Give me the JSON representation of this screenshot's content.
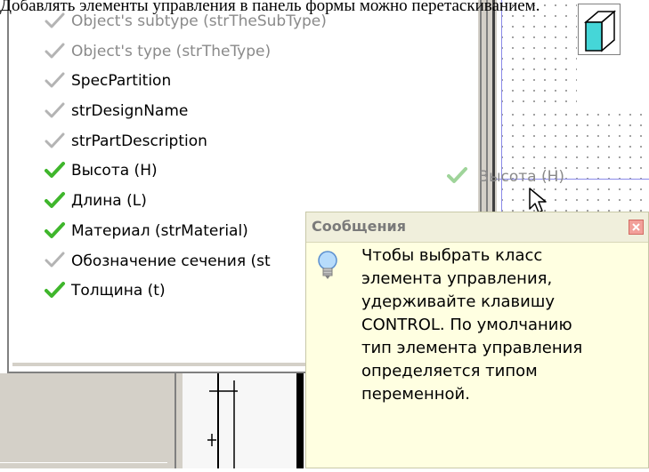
{
  "caption": "Добавлять элементы управления в панель формы можно перетаскиванием.",
  "variables": [
    {
      "label": "Object's subtype (strTheSubType)",
      "checked": false,
      "disabled": true
    },
    {
      "label": "Object's type (strTheType)",
      "checked": false,
      "disabled": true
    },
    {
      "label": "SpecPartition",
      "checked": false,
      "disabled": false
    },
    {
      "label": "strDesignName",
      "checked": false,
      "disabled": false
    },
    {
      "label": "strPartDescription",
      "checked": false,
      "disabled": false
    },
    {
      "label": "Высота (H)",
      "checked": true,
      "disabled": false,
      "selected": true
    },
    {
      "label": "Длина (L)",
      "checked": true,
      "disabled": false
    },
    {
      "label": "Материал (strMaterial)",
      "checked": true,
      "disabled": false
    },
    {
      "label": "Обозначение сечения (st",
      "checked": false,
      "disabled": false
    },
    {
      "label": "Толщина (t)",
      "checked": true,
      "disabled": false
    }
  ],
  "drag_ghost": {
    "label": "Высота (H)"
  },
  "message": {
    "title": "Сообщения",
    "lines": [
      "Чтобы выбрать класс",
      "элемента управления,",
      "удерживайте клавишу",
      "CONTROL. По умолчанию",
      "тип элемента управления",
      "определяется типом",
      "переменной."
    ]
  },
  "colors": {
    "check_active": "#3fb62c",
    "check_inactive": "#b4b4b4",
    "tooltip_bg": "#ffffe1",
    "close_btn": "#f2a09a"
  },
  "icons": {
    "check": "checkmark-icon",
    "bulb": "lightbulb-icon",
    "close": "close-icon",
    "cursor": "arrow-cursor-icon",
    "cube": "cube-icon"
  }
}
